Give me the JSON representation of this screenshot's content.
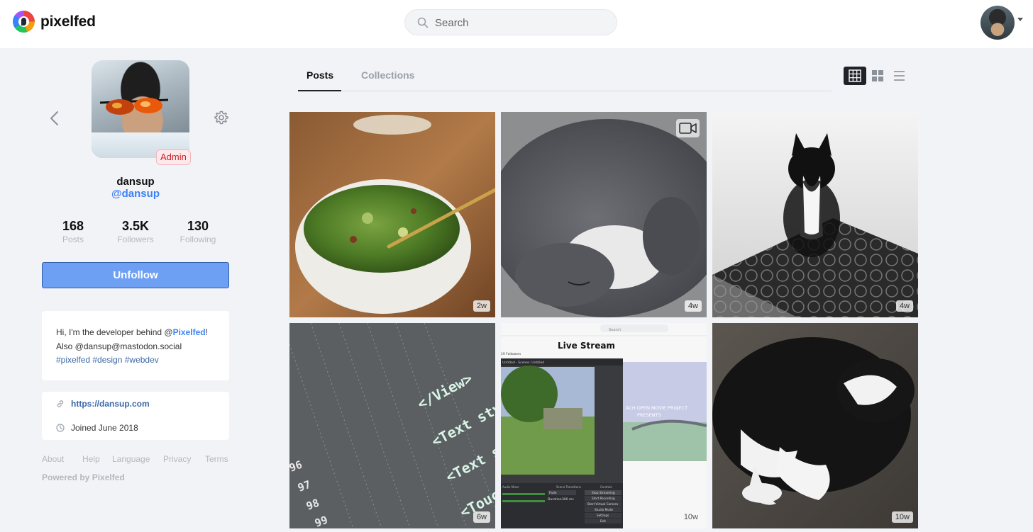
{
  "app": {
    "name": "pixelfed"
  },
  "search": {
    "placeholder": "Search"
  },
  "profile": {
    "badge": "Admin",
    "display_name": "dansup",
    "username": "@dansup",
    "stats": [
      {
        "value": "168",
        "label": "Posts"
      },
      {
        "value": "3.5K",
        "label": "Followers"
      },
      {
        "value": "130",
        "label": "Following"
      }
    ],
    "follow_button": "Unfollow",
    "bio": {
      "line1_pre": "Hi, I'm the developer behind @",
      "line1_link": "Pixelfed",
      "line1_post": "!",
      "line2": "Also @dansup@mastodon.social",
      "tags": "#pixelfed #design #webdev"
    },
    "website": "https://dansup.com",
    "joined": "Joined June 2018"
  },
  "footer": {
    "links": [
      "About",
      "Help",
      "Language",
      "Privacy",
      "Terms"
    ],
    "powered": "Powered by Pixelfed"
  },
  "tabs": [
    {
      "label": "Posts",
      "active": true
    },
    {
      "label": "Collections",
      "active": false
    }
  ],
  "view_modes": [
    "grid-icon",
    "masonry-icon",
    "list-icon"
  ],
  "posts": [
    {
      "time": "2w",
      "subject": "salad-bowl",
      "video": false
    },
    {
      "time": "4w",
      "subject": "grey-cat",
      "video": true
    },
    {
      "time": "4w",
      "subject": "tuxedo-cat",
      "video": false
    },
    {
      "time": "6w",
      "subject": "code-screen",
      "video": false
    },
    {
      "time": "10w",
      "subject": "live-stream",
      "video": false
    },
    {
      "time": "10w",
      "subject": "sleeping-cat",
      "video": false
    }
  ],
  "live_stream": {
    "search": "Search",
    "title": "Live Stream",
    "scenes": "Untitled - Scenes: Untitled",
    "movie": "ACH OPEN MOVIE PROJECT",
    "presents": "PRESENTS",
    "controls": [
      "Stop Streaming",
      "Start Recording",
      "Start Virtual Camera",
      "Studio Mode",
      "Settings",
      "Exit"
    ],
    "fade": "Fade",
    "duration": "Duration",
    "duration_value": "300 ms",
    "mixer": "Audio Mixer",
    "transitions": "Scene Transitions",
    "controls_label": "Controls",
    "followers": "19 Followers"
  },
  "code_screen": {
    "lines": [
      "</View>",
      "<Text styl",
      "<Text st",
      "<Touch"
    ],
    "numbers": [
      "96",
      "97",
      "98",
      "99"
    ]
  },
  "colors": {
    "accent": "#3b82f6",
    "button": "#6d9ff3",
    "admin": "#c8232f"
  }
}
